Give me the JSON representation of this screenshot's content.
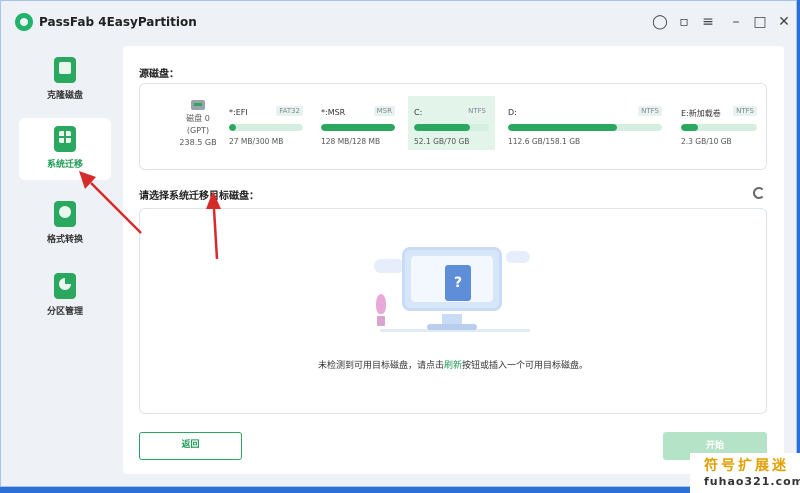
{
  "app": {
    "title": "PassFab 4EasyPartition"
  },
  "titlebar": {
    "icons": [
      "user-icon",
      "feedback-icon",
      "menu-icon",
      "minimize-icon",
      "maximize-icon",
      "close-icon"
    ]
  },
  "sidebar": {
    "items": [
      {
        "label": "克隆磁盘",
        "icon": "clone-disk-icon",
        "active": false
      },
      {
        "label": "系统迁移",
        "icon": "system-migrate-icon",
        "active": true
      },
      {
        "label": "格式转换",
        "icon": "format-convert-icon",
        "active": false
      },
      {
        "label": "分区管理",
        "icon": "partition-manage-icon",
        "active": false
      }
    ]
  },
  "source": {
    "label": "源磁盘：",
    "disk": {
      "name": "磁盘 0",
      "style": "(GPT)",
      "size": "238.5 GB"
    },
    "partitions": [
      {
        "name": "*:EFI",
        "fs": "FAT32",
        "size": "27 MB/300 MB",
        "used": 0.09,
        "selected": false
      },
      {
        "name": "*:MSR",
        "fs": "MSR",
        "size": "128 MB/128 MB",
        "used": 1.0,
        "selected": false
      },
      {
        "name": "C:",
        "fs": "NTFS",
        "size": "52.1 GB/70 GB",
        "used": 0.74,
        "selected": true
      },
      {
        "name": "D:",
        "fs": "NTFS",
        "size": "112.6 GB/158.1 GB",
        "used": 0.71,
        "selected": false
      },
      {
        "name": "E:新加载卷",
        "fs": "NTFS",
        "size": "2.3 GB/10 GB",
        "used": 0.23,
        "selected": false
      }
    ]
  },
  "target": {
    "label": "请选择系统迁移目标磁盘：",
    "empty_pre": "未检测到可用目标磁盘，请点击",
    "empty_link": "刷新",
    "empty_post": "按钮或插入一个可用目标磁盘。",
    "illustration_mark": "?"
  },
  "buttons": {
    "back": "返回",
    "start": "开始"
  },
  "watermark": {
    "cn": "符号扩展迷",
    "en": "fuhao321.com"
  },
  "colors": {
    "accent": "#2aa85f",
    "arrow": "#d62b2b",
    "disabled": "#b5e3c7"
  }
}
